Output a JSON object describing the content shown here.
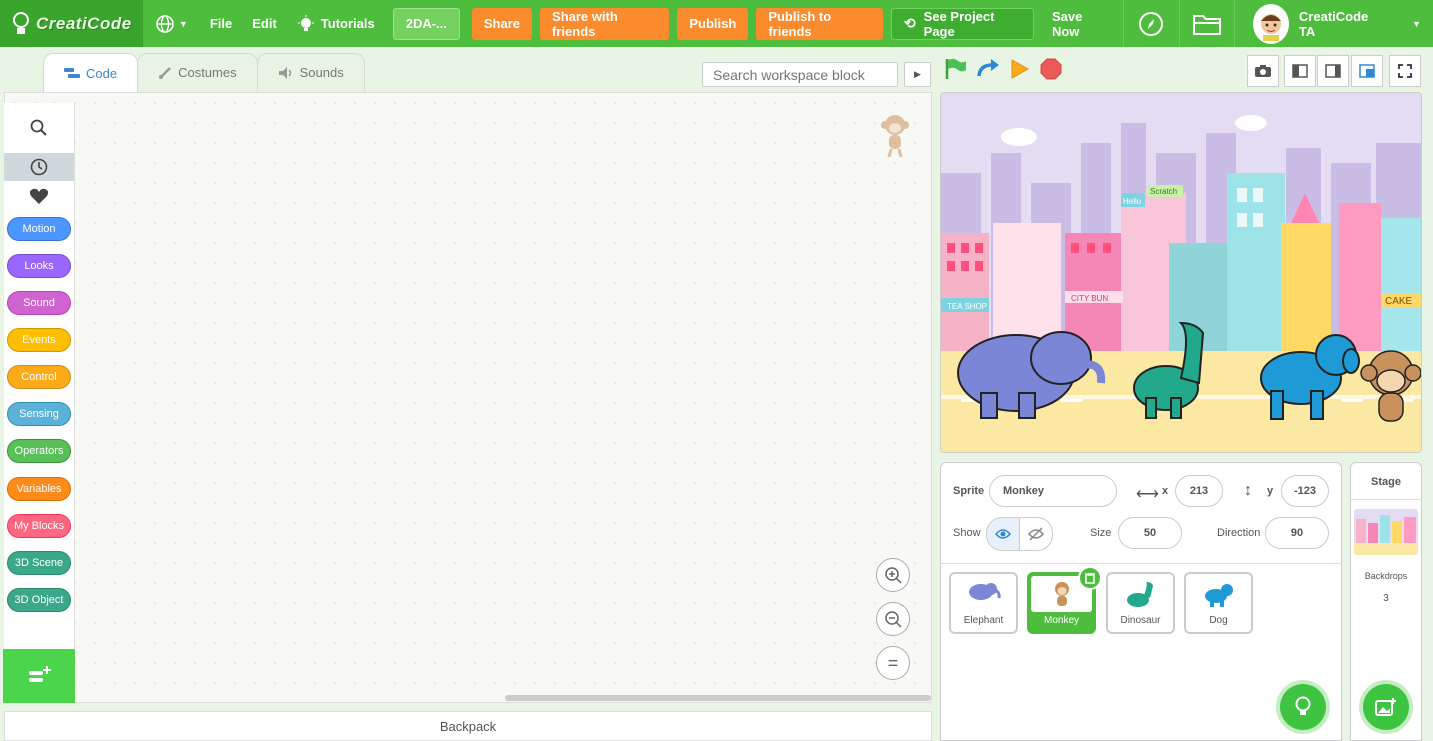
{
  "topbar": {
    "logo": "CreatiCode",
    "menu_file": "File",
    "menu_edit": "Edit",
    "tutorials": "Tutorials",
    "project_title": "2DA-...",
    "share": "Share",
    "share_friends": "Share with friends",
    "publish": "Publish",
    "publish_friends": "Publish to friends",
    "see_project": "See Project Page",
    "save_now": "Save Now",
    "username": "CreatiCode TA"
  },
  "tabs": [
    {
      "label": "Code",
      "icon": "code-icon"
    },
    {
      "label": "Costumes",
      "icon": "brush-icon"
    },
    {
      "label": "Sounds",
      "icon": "speaker-icon"
    }
  ],
  "search": {
    "placeholder": "Search workspace block"
  },
  "categories": [
    {
      "label": "Motion",
      "color": "#4c97ff"
    },
    {
      "label": "Looks",
      "color": "#9966ff"
    },
    {
      "label": "Sound",
      "color": "#cf63cf"
    },
    {
      "label": "Events",
      "color": "#ffbf00"
    },
    {
      "label": "Control",
      "color": "#ffab19"
    },
    {
      "label": "Sensing",
      "color": "#5cb1d6"
    },
    {
      "label": "Operators",
      "color": "#59c059"
    },
    {
      "label": "Variables",
      "color": "#ff8c1a"
    },
    {
      "label": "My Blocks",
      "color": "#ff6680"
    },
    {
      "label": "3D Scene",
      "color": "#3aa889"
    },
    {
      "label": "3D Object",
      "color": "#3aa889"
    }
  ],
  "sprite_info": {
    "sprite_label": "Sprite",
    "sprite_name": "Monkey",
    "x_label": "x",
    "x_value": "213",
    "y_label": "y",
    "y_value": "-123",
    "show_label": "Show",
    "size_label": "Size",
    "size_value": "50",
    "direction_label": "Direction",
    "direction_value": "90"
  },
  "sprites": [
    {
      "name": "Elephant",
      "selected": false
    },
    {
      "name": "Monkey",
      "selected": true
    },
    {
      "name": "Dinosaur",
      "selected": false
    },
    {
      "name": "Dog",
      "selected": false
    }
  ],
  "stage_panel": {
    "title": "Stage",
    "backdrops_label": "Backdrops",
    "backdrops_count": "3"
  },
  "stage_scene": {
    "sign_tea_shop": "TEA SHOP",
    "sign_city_bun": "CITY BUN",
    "sign_cake": "CAKE",
    "sign_hello": "Hello",
    "sign_scratch": "Scratch"
  },
  "backpack": "Backpack",
  "colors": {
    "topbar": "#4ebd3e",
    "orange": "#fb8b2c",
    "code_tab": "#3d86d6"
  }
}
